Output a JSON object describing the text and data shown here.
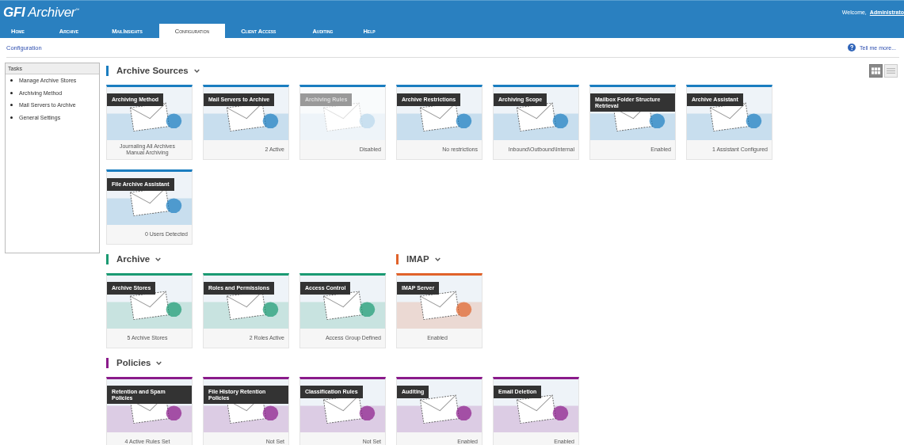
{
  "header": {
    "logo": "**GFI** Archiver$^{™}$",
    "welcome": "Welcome,",
    "user": "Administrato"
  },
  "nav_tabs": [
    {
      "label": "Home",
      "selected": false
    },
    {
      "label": "Archive",
      "selected": false
    },
    {
      "label": "MailInsights",
      "selected": false
    },
    {
      "label": "Configuration",
      "selected": true
    },
    {
      "label": "Client Access",
      "selected": false
    },
    {
      "label": "Auditing",
      "selected": false
    },
    {
      "label": "Help",
      "selected": false
    }
  ],
  "breadcrumb": "Configuration",
  "help_link": "Tell me more...",
  "view_toggle": [
    {
      "kind": "grid",
      "selected": true
    },
    {
      "kind": "list",
      "selected": false
    }
  ],
  "sidebar": {
    "title": "Tasks",
    "items": [
      "Manage Archive Stores",
      "Archiving Method",
      "Mail Servers to Archive",
      "General Settings"
    ]
  },
  "section_rows": [
    [
      {
        "title": "Archive Sources",
        "color": "#1a7dc0",
        "cards": [
          {
            "title": "Archiving Method",
            "status": [
              "Journaling All Archives",
              "Manual Archiving"
            ],
            "disabled": false
          },
          {
            "title": "Mail Servers to Archive",
            "status": [
              "2 Active"
            ],
            "disabled": false
          },
          {
            "title": "Archiving Rules",
            "status": [
              "Disabled"
            ],
            "disabled": true
          },
          {
            "title": "Archive Restrictions",
            "status": [
              "No restrictions"
            ],
            "disabled": false
          },
          {
            "title": "Archiving Scope",
            "status": [
              "Inbound\\Outbound\\Internal"
            ],
            "disabled": false
          },
          {
            "title": "Mailbox Folder Structure Retrieval",
            "status": [
              "Enabled"
            ],
            "disabled": false
          },
          {
            "title": "Archive Assistant",
            "status": [
              "1 Assistant Configured"
            ],
            "disabled": false
          },
          {
            "title": "File Archive Assistant",
            "status": [
              "0 Users Detected"
            ],
            "disabled": false
          }
        ]
      }
    ],
    [
      {
        "title": "Archive",
        "color": "#1a9a72",
        "cards": [
          {
            "title": "Archive Stores",
            "status": [
              "5 Archive Stores"
            ],
            "disabled": false
          },
          {
            "title": "Roles and Permissions",
            "status": [
              "2 Roles Active"
            ],
            "disabled": false
          },
          {
            "title": "Access Control",
            "status": [
              "Access Group Defined"
            ],
            "disabled": false
          }
        ]
      },
      {
        "title": "IMAP",
        "color": "#e0622a",
        "cards": [
          {
            "title": "IMAP Server",
            "status": [
              "Enabled"
            ],
            "disabled": false
          }
        ]
      }
    ],
    [
      {
        "title": "Policies",
        "color": "#8a1a8a",
        "cards": [
          {
            "title": "Retention and Spam Policies",
            "status": [
              "4 Active Rules Set"
            ],
            "disabled": false
          },
          {
            "title": "File History Retention Policies",
            "status": [
              "Not Set"
            ],
            "disabled": false
          },
          {
            "title": "Classification Rules",
            "status": [
              "Not Set"
            ],
            "disabled": false
          },
          {
            "title": "Auditing",
            "status": [
              "Enabled"
            ],
            "disabled": false
          },
          {
            "title": "Email Deletion",
            "status": [
              "Enabled"
            ],
            "disabled": false
          }
        ]
      }
    ]
  ]
}
